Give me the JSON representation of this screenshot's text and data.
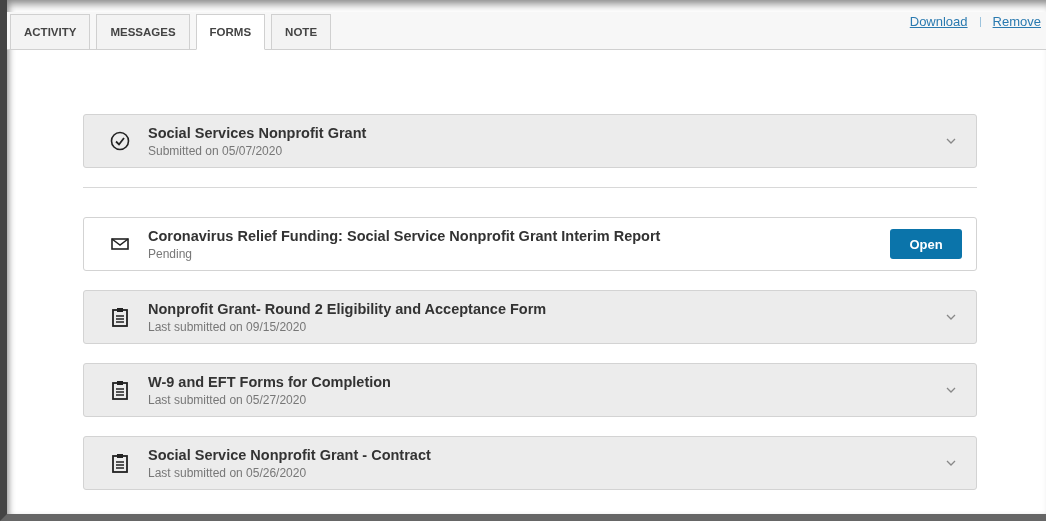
{
  "tabs": [
    {
      "label": "ACTIVITY",
      "selected": false
    },
    {
      "label": "MESSAGES",
      "selected": false
    },
    {
      "label": "FORMS",
      "selected": true
    },
    {
      "label": "NOTE",
      "selected": false
    }
  ],
  "links": [
    "Download",
    "Remove"
  ],
  "completed": [
    {
      "kind": "check",
      "title": "Social Services Nonprofit Grant",
      "subtitle": "Submitted on 05/07/2020"
    }
  ],
  "forms": [
    {
      "kind": "mail",
      "title": "Coronavirus Relief Funding: Social Service Nonprofit Grant Interim Report",
      "subtitle": "Pending",
      "button": "Open"
    },
    {
      "kind": "clipboard",
      "title": "Nonprofit Grant- Round 2 Eligibility and Acceptance Form",
      "subtitle": "Last submitted on 09/15/2020"
    },
    {
      "kind": "clipboard",
      "title": "W-9 and EFT Forms for Completion",
      "subtitle": "Last submitted on 05/27/2020"
    },
    {
      "kind": "clipboard",
      "title": "Social Service Nonprofit Grant - Contract",
      "subtitle": "Last submitted on 05/26/2020"
    }
  ]
}
